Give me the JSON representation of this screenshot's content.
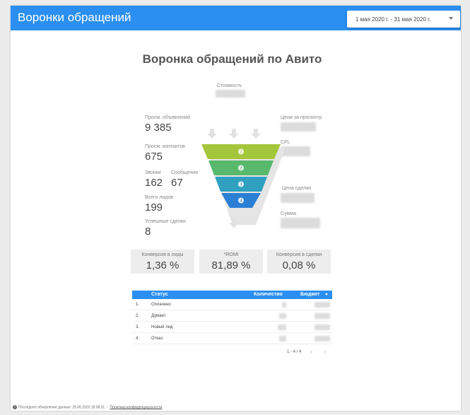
{
  "header": {
    "title": "Воронки обращений",
    "date_range": "1 мая 2020 г. - 31 мая 2020 г."
  },
  "page_title": "Воронка обращений по Авито",
  "metrics_left": [
    {
      "label": "Просм. объявлений",
      "value": "9 385"
    },
    {
      "label": "Просм. контактов",
      "value": "675"
    },
    {
      "label": "Звонки",
      "value": "162"
    },
    {
      "label": "Сообщения",
      "value": "67"
    },
    {
      "label": "Всего лидов",
      "value": "199"
    },
    {
      "label": "Успешные сделки",
      "value": "8"
    }
  ],
  "metrics_right": {
    "cost_label": "Стоимость",
    "cost_per_view_label": "Цена за просмотр",
    "cpl_label": "CPL",
    "deal_price_label": "Цена сделки",
    "sum_label": "Сумма"
  },
  "funnel": {
    "stages": [
      "1",
      "2",
      "3",
      "4"
    ],
    "colors": [
      "#a4c63a",
      "#58b86c",
      "#2fa0c0",
      "#2a7fd4"
    ]
  },
  "kpis": [
    {
      "label": "Конверсия в лиды",
      "value": "1,36 %"
    },
    {
      "label": "*ROMI",
      "value": "81,89 %"
    },
    {
      "label": "Конверсия в сделки",
      "value": "0,08 %"
    }
  ],
  "table": {
    "headers": {
      "status": "Статус",
      "count": "Количество",
      "budget": "Бюджет"
    },
    "rows": [
      {
        "index": "1.",
        "status": "Оплачено"
      },
      {
        "index": "2.",
        "status": "Думает"
      },
      {
        "index": "3.",
        "status": "Новый лид"
      },
      {
        "index": "4.",
        "status": "Отказ"
      }
    ],
    "pagination": "1 - 4 / 4",
    "prev_icon": "chevron-left-icon",
    "next_icon": "chevron-right-icon"
  },
  "footer": {
    "updated": "Последнее обновление данных: 29.06.2020 18:08:31",
    "privacy": "Политика конфиденциальности"
  },
  "colors": {
    "accent": "#2a8ff0",
    "kpi_bg": "#ededed"
  }
}
